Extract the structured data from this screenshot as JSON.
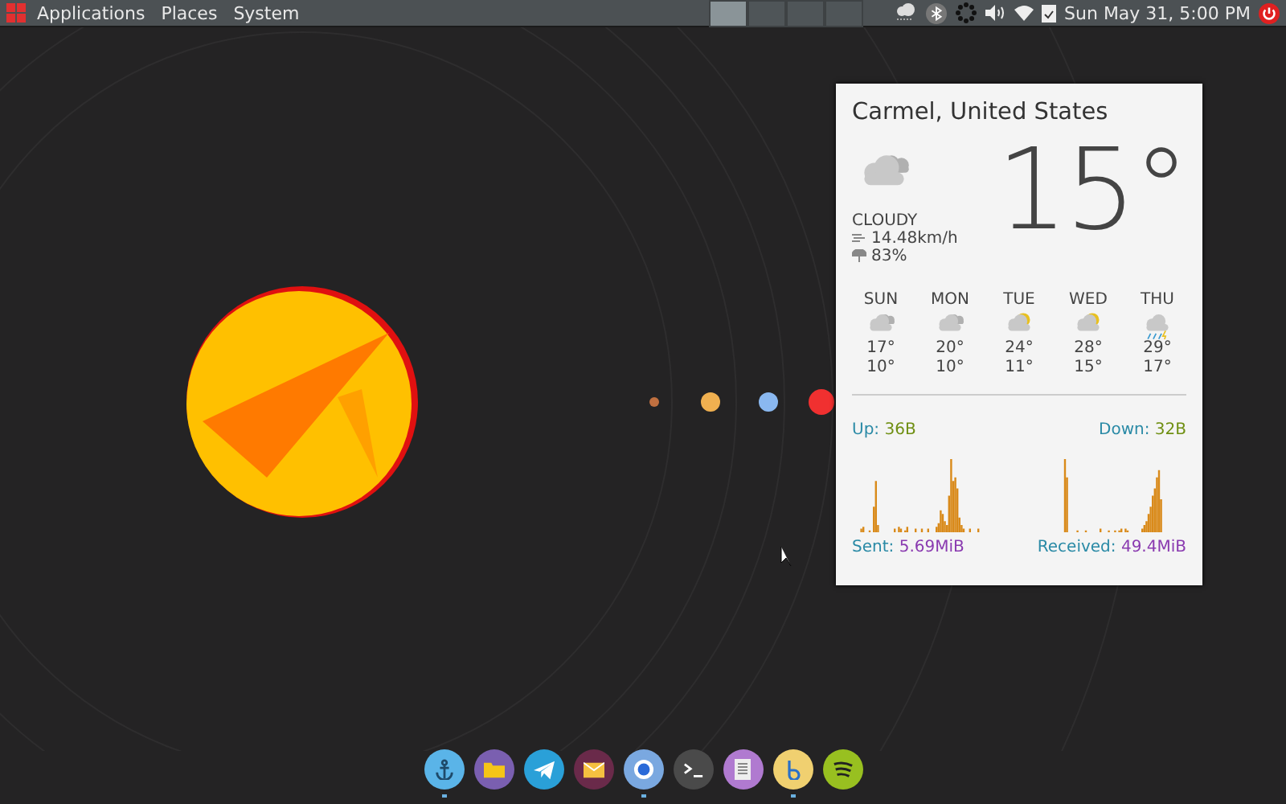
{
  "top_panel": {
    "menus": [
      "Applications",
      "Places",
      "System"
    ],
    "workspaces": [
      {
        "selected": true
      },
      {
        "selected": false
      },
      {
        "selected": false
      },
      {
        "selected": false
      }
    ],
    "clock": "Sun May 31,  5:00 PM"
  },
  "weather": {
    "location": "Carmel, United States",
    "temperature": "15°",
    "condition": "CLOUDY",
    "kind": "cloudy",
    "wind": "14.48km/h",
    "humidity": "83%",
    "forecast": [
      {
        "day": "SUN",
        "kind": "cloudy",
        "high": "17°",
        "low": "10°"
      },
      {
        "day": "MON",
        "kind": "cloudy",
        "high": "20°",
        "low": "10°"
      },
      {
        "day": "TUE",
        "kind": "partly-sunny",
        "high": "24°",
        "low": "11°"
      },
      {
        "day": "WED",
        "kind": "partly-sunny",
        "high": "28°",
        "low": "15°"
      },
      {
        "day": "THU",
        "kind": "storm",
        "high": "29°",
        "low": "17°"
      }
    ]
  },
  "network": {
    "up_label": "Up:",
    "up_value": "36B",
    "down_label": "Down:",
    "down_value": "32B",
    "sent_label": "Sent:",
    "sent_value": "5.69MiB",
    "received_label": "Received:",
    "received_value": "49.4MiB"
  },
  "dock": [
    {
      "kind": "anchor",
      "running": true
    },
    {
      "kind": "folder",
      "running": false
    },
    {
      "kind": "telegram",
      "running": false
    },
    {
      "kind": "mail",
      "running": false
    },
    {
      "kind": "browser",
      "running": true
    },
    {
      "kind": "terminal",
      "running": false
    },
    {
      "kind": "document",
      "running": false
    },
    {
      "kind": "b-app",
      "running": true
    },
    {
      "kind": "music",
      "running": false
    }
  ]
}
